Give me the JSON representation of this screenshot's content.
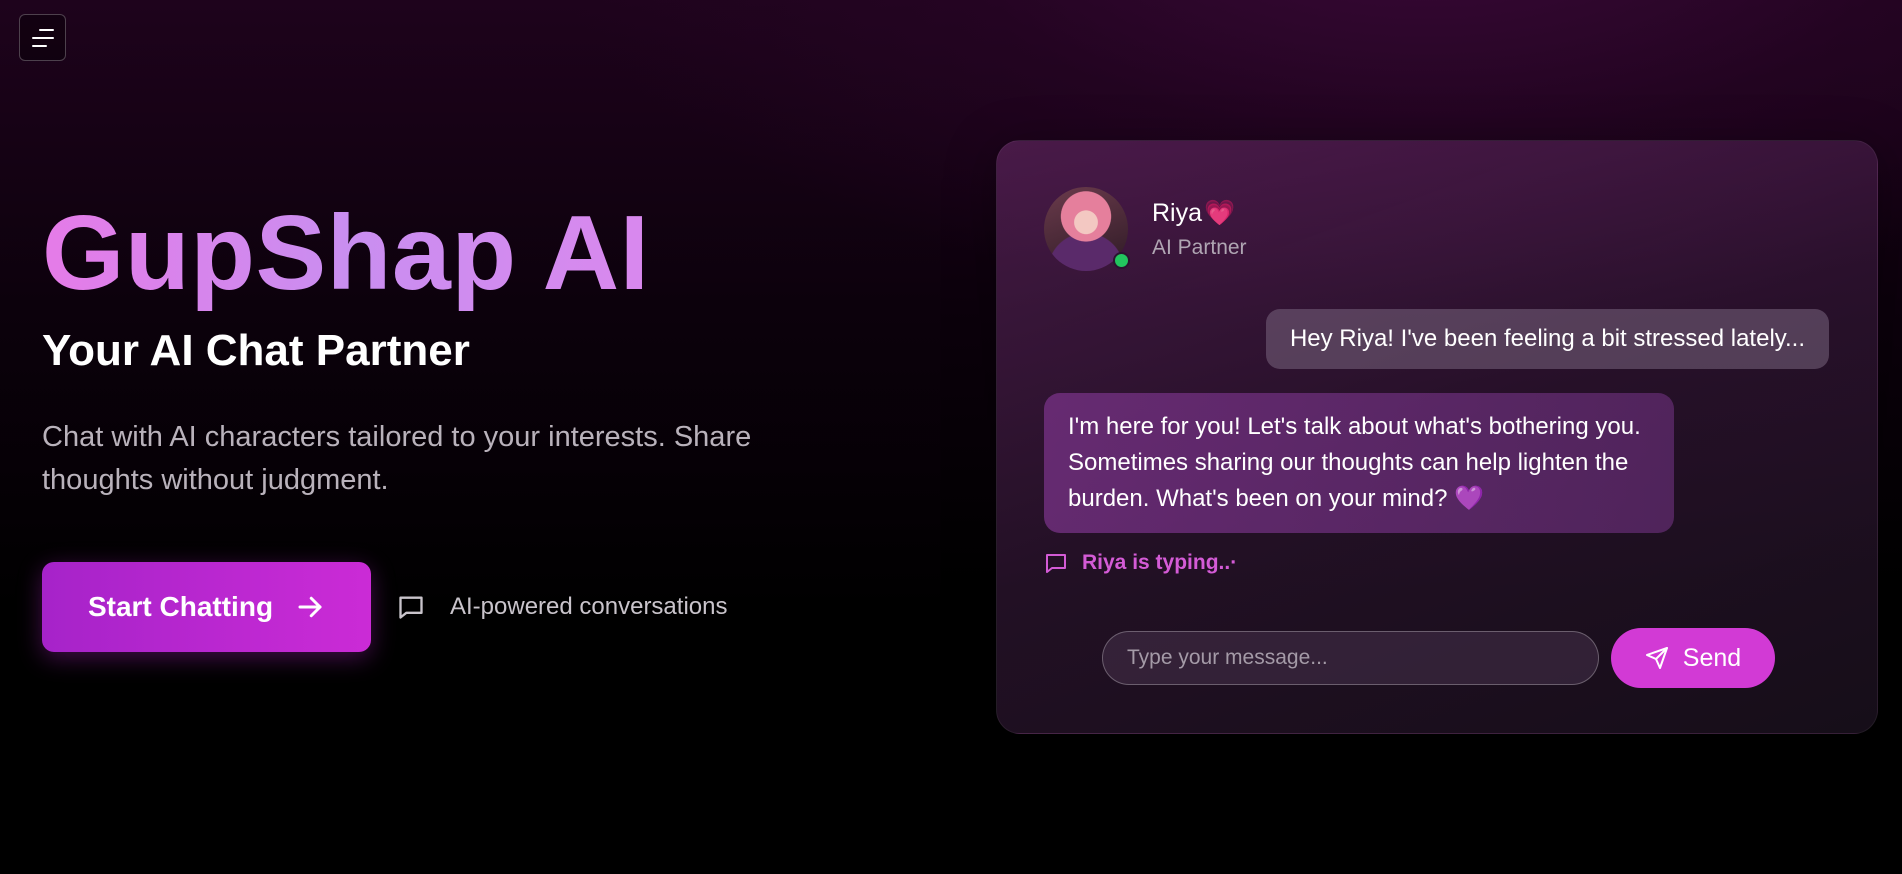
{
  "header": {
    "menu_icon": "menu-icon"
  },
  "hero": {
    "brand": "GupShap AI",
    "subtitle": "Your AI Chat Partner",
    "description": "Chat with AI characters tailored to your interests. Share thoughts without judgment.",
    "cta_label": "Start Chatting",
    "cta_icon": "arrow-right-icon",
    "feature_icon": "message-square-icon",
    "feature_label": "AI-powered conversations"
  },
  "chat": {
    "character_name": "Riya",
    "character_emoji": "💗",
    "character_role": "AI Partner",
    "status": "online",
    "messages": [
      {
        "sender": "user",
        "text": "Hey Riya! I've been feeling a bit stressed lately..."
      },
      {
        "sender": "ai",
        "text": "I'm here for you! Let's talk about what's bothering you. Sometimes sharing our thoughts can help lighten the burden. What's been on your mind? 💜"
      }
    ],
    "typing_text": "Riya is typing..·",
    "input_placeholder": "Type your message...",
    "send_label": "Send",
    "send_icon": "send-icon"
  },
  "colors": {
    "accent": "#cb2bd6",
    "brand_gradient_start": "#e57be8",
    "brand_gradient_end": "#c98ef0",
    "online": "#22c55e",
    "typing": "#d45bd6"
  }
}
